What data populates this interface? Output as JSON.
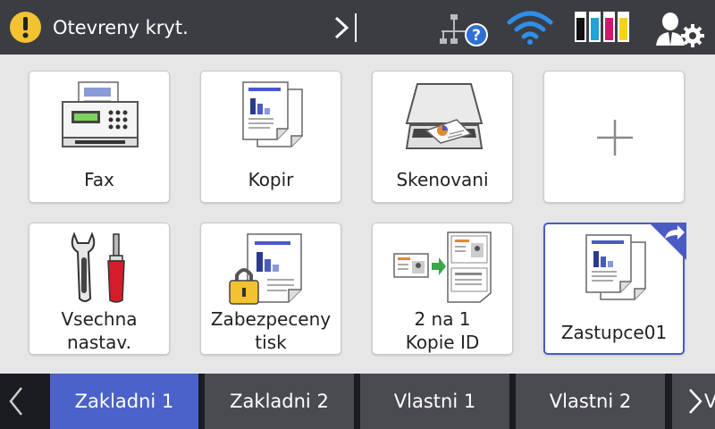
{
  "status": {
    "message": "Otevreny kryt.",
    "warning_icon": "warning-icon"
  },
  "header_icons": [
    "network-help-icon",
    "wifi-icon",
    "ink-level-icon",
    "user-settings-icon"
  ],
  "tiles": [
    {
      "id": "fax",
      "label": "Fax",
      "icon": "fax-icon"
    },
    {
      "id": "copy",
      "label": "Kopir",
      "icon": "copy-icon"
    },
    {
      "id": "scan",
      "label": "Skenovani",
      "icon": "scanner-icon"
    },
    {
      "id": "add",
      "label": "",
      "icon": "plus-icon"
    },
    {
      "id": "settings",
      "label_line1": "Vsechna",
      "label_line2": "nastav.",
      "icon": "tools-icon"
    },
    {
      "id": "secure",
      "label_line1": "Zabezpeceny",
      "label_line2": "tisk",
      "icon": "secure-print-icon"
    },
    {
      "id": "idcopy",
      "label_line1": "2 na 1",
      "label_line2": "Kopie ID",
      "icon": "id-copy-icon"
    },
    {
      "id": "shortcut",
      "label": "Zastupce01",
      "icon": "shortcut-icon"
    }
  ],
  "tabs": [
    "Zakladni 1",
    "Zakladni 2",
    "Vlastni 1",
    "Vlastni 2"
  ],
  "active_tab": "Zakladni 1",
  "next_tab_text": "V",
  "colors": {
    "topbar": "#3b3d42",
    "accent": "#4a62c9",
    "warning": "#f2c230",
    "wifi": "#2e8ee8"
  }
}
